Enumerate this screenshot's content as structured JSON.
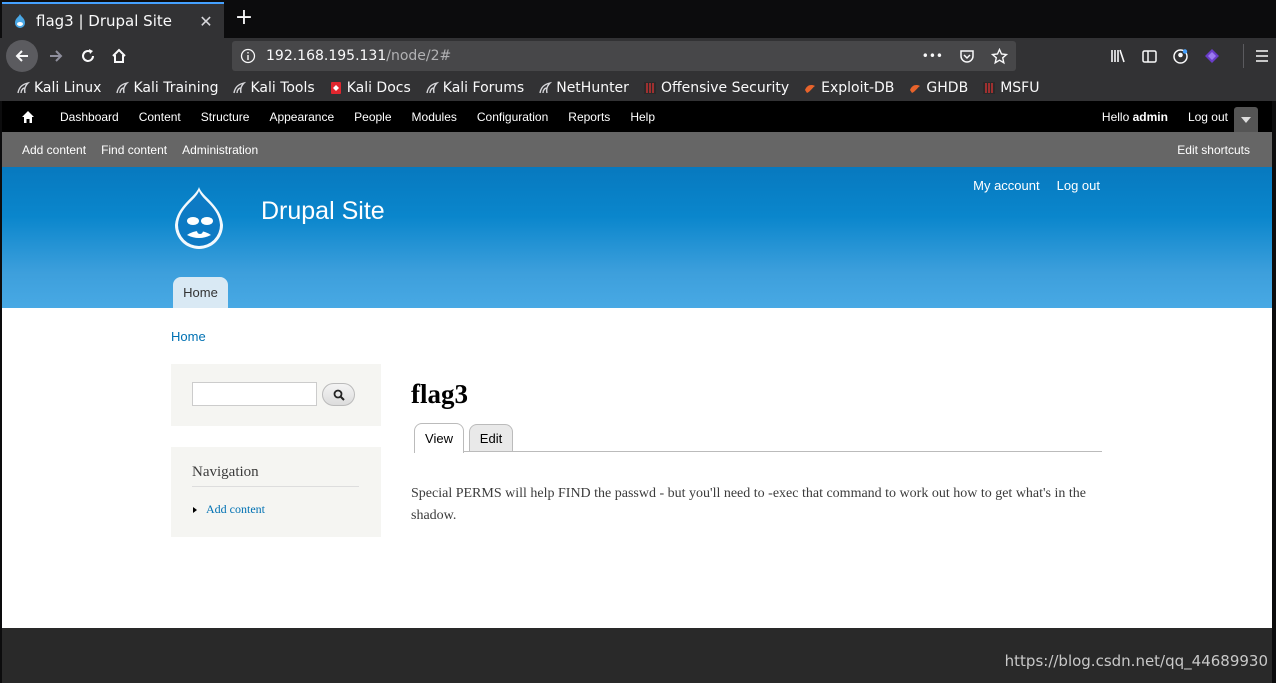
{
  "browser": {
    "tab_title": "flag3 | Drupal Site",
    "url_host": "192.168.195.131",
    "url_path": "/node/2#",
    "url_actions": "•••"
  },
  "bookmarks": [
    {
      "label": "Kali Linux",
      "icon": "kali-dragon-icon"
    },
    {
      "label": "Kali Training",
      "icon": "kali-dragon-icon"
    },
    {
      "label": "Kali Tools",
      "icon": "kali-dragon-icon"
    },
    {
      "label": "Kali Docs",
      "icon": "kali-docs-icon"
    },
    {
      "label": "Kali Forums",
      "icon": "kali-dragon-icon"
    },
    {
      "label": "NetHunter",
      "icon": "kali-dragon-icon"
    },
    {
      "label": "Offensive Security",
      "icon": "offsec-icon"
    },
    {
      "label": "Exploit-DB",
      "icon": "exploit-db-icon"
    },
    {
      "label": "GHDB",
      "icon": "exploit-db-icon"
    },
    {
      "label": "MSFU",
      "icon": "offsec-icon"
    }
  ],
  "admin_toolbar": {
    "menu": [
      "Dashboard",
      "Content",
      "Structure",
      "Appearance",
      "People",
      "Modules",
      "Configuration",
      "Reports",
      "Help"
    ],
    "hello": "Hello ",
    "username": "admin",
    "logout": "Log out"
  },
  "shortcuts": {
    "items": [
      "Add content",
      "Find content",
      "Administration"
    ],
    "edit": "Edit shortcuts"
  },
  "header": {
    "site_name": "Drupal Site",
    "my_account": "My account",
    "log_out": "Log out",
    "home_tab": "Home"
  },
  "breadcrumb": "Home",
  "sidebar": {
    "navigation_title": "Navigation",
    "nav_link": "Add content"
  },
  "node": {
    "title": "flag3",
    "tab_view": "View",
    "tab_edit": "Edit",
    "body": "Special PERMS will help FIND the passwd - but you'll need to -exec that command to work out how to get what's in the shadow."
  },
  "watermark": "https://blog.csdn.net/qq_44689930",
  "colors": {
    "header_blue": "#0779bf",
    "link_blue": "#0071b3",
    "admin_bar": "#000000",
    "shortcut_bar": "#666666",
    "footer": "#292929"
  }
}
